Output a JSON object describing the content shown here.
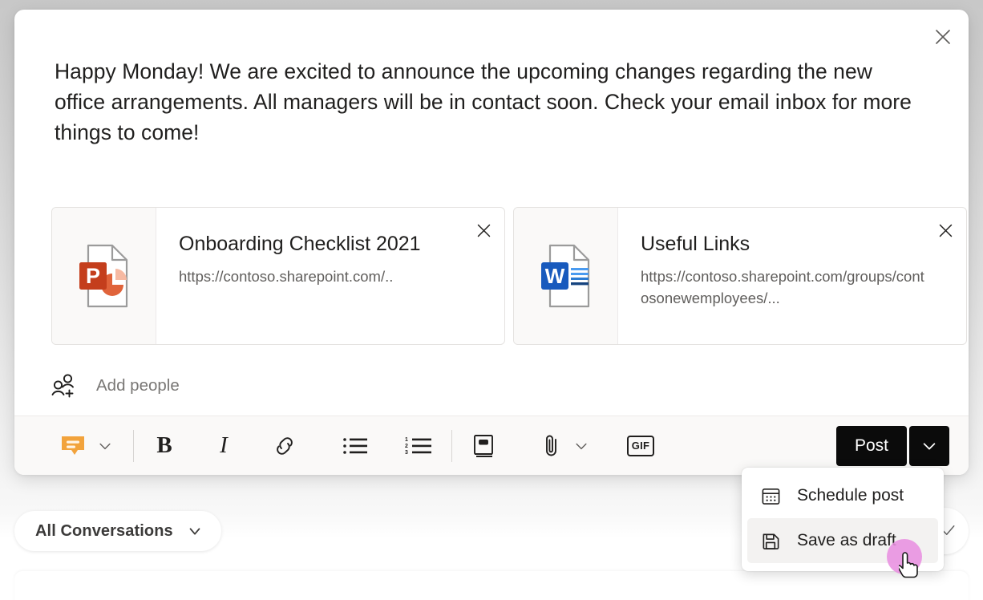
{
  "composer": {
    "close_label": "close-icon",
    "message_text": "Happy Monday! We are excited to announce the upcoming changes regarding the new office arrangements. All managers will be in contact soon. Check your email inbox for more things to come!",
    "attachments": [
      {
        "icon": "powerpoint-file-icon",
        "title": "Onboarding Checklist 2021",
        "url": "https://contoso.sharepoint.com/..",
        "remove_label": "remove-attachment"
      },
      {
        "icon": "word-file-icon",
        "title": "Useful Links",
        "url": "https://contoso.sharepoint.com/groups/contosonewemployees/...",
        "remove_label": "remove-attachment"
      }
    ],
    "add_people": {
      "icon": "add-people-icon",
      "placeholder": "Add people"
    },
    "toolbar": {
      "message_type_icon": "message-bubble-icon",
      "message_type_chevron": "chevron-down-icon",
      "bold_label": "B",
      "italic_label": "I",
      "link_icon": "link-icon",
      "bulleted_list_icon": "bulleted-list-icon",
      "numbered_list_icon": "numbered-list-icon",
      "announcement_icon": "announcement-icon",
      "attach_icon": "paperclip-icon",
      "attach_chevron": "chevron-down-icon",
      "gif_label": "GIF"
    },
    "post": {
      "label": "Post",
      "caret_icon": "chevron-down-icon"
    }
  },
  "post_menu": {
    "items": [
      {
        "icon": "calendar-icon",
        "label": "Schedule post",
        "hovered": false
      },
      {
        "icon": "save-floppy-icon",
        "label": "Save as draft",
        "hovered": true
      }
    ]
  },
  "conversations_filter": {
    "label": "All Conversations",
    "chevron_icon": "chevron-down-icon"
  },
  "colors": {
    "post_button_bg": "#0b0b0b",
    "message_icon_accent": "#f2a33c",
    "powerpoint_accent": "#c43e1c",
    "word_accent": "#185abd",
    "click_indicator": "#e88fe0",
    "hover_row": "#f3f2f1"
  }
}
